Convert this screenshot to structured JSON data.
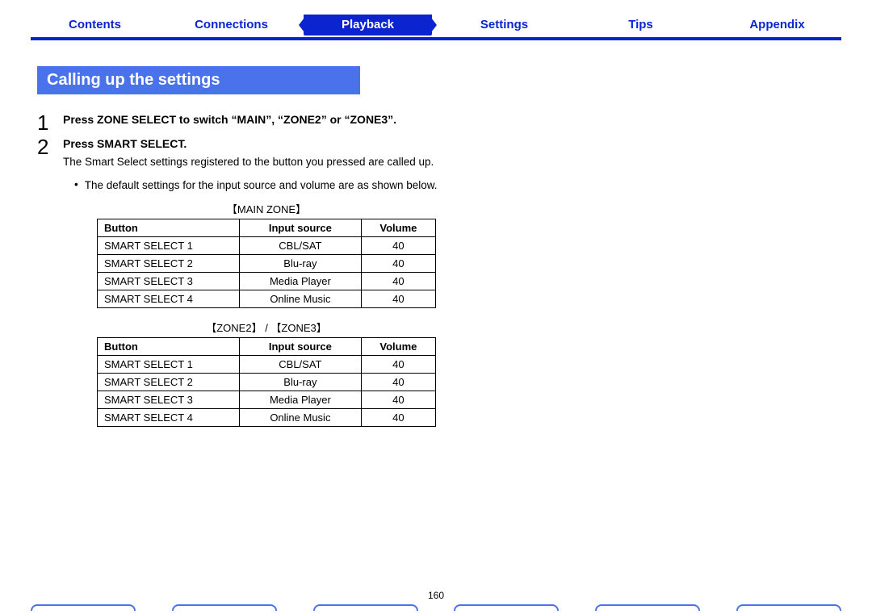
{
  "tabs": {
    "items": [
      {
        "label": "Contents",
        "active": false
      },
      {
        "label": "Connections",
        "active": false
      },
      {
        "label": "Playback",
        "active": true
      },
      {
        "label": "Settings",
        "active": false
      },
      {
        "label": "Tips",
        "active": false
      },
      {
        "label": "Appendix",
        "active": false
      }
    ]
  },
  "section": {
    "title": "Calling up the settings"
  },
  "steps": [
    {
      "num": "1",
      "title": "Press ZONE SELECT to switch “MAIN”, “ZONE2” or “ZONE3”."
    },
    {
      "num": "2",
      "title": "Press SMART SELECT.",
      "desc": "The Smart Select settings registered to the button you pressed are called up."
    }
  ],
  "bullet": "The default settings for the input source and volume are as shown below.",
  "tables": [
    {
      "caption": "【MAIN ZONE】",
      "headers": {
        "button": "Button",
        "input": "Input source",
        "volume": "Volume"
      },
      "rows": [
        {
          "button": "SMART SELECT 1",
          "input": "CBL/SAT",
          "volume": "40"
        },
        {
          "button": "SMART SELECT 2",
          "input": "Blu-ray",
          "volume": "40"
        },
        {
          "button": "SMART SELECT 3",
          "input": "Media Player",
          "volume": "40"
        },
        {
          "button": "SMART SELECT 4",
          "input": "Online Music",
          "volume": "40"
        }
      ]
    },
    {
      "caption": "【ZONE2】 / 【ZONE3】",
      "headers": {
        "button": "Button",
        "input": "Input source",
        "volume": "Volume"
      },
      "rows": [
        {
          "button": "SMART SELECT 1",
          "input": "CBL/SAT",
          "volume": "40"
        },
        {
          "button": "SMART SELECT 2",
          "input": "Blu-ray",
          "volume": "40"
        },
        {
          "button": "SMART SELECT 3",
          "input": "Media Player",
          "volume": "40"
        },
        {
          "button": "SMART SELECT 4",
          "input": "Online Music",
          "volume": "40"
        }
      ]
    }
  ],
  "page_number": "160"
}
